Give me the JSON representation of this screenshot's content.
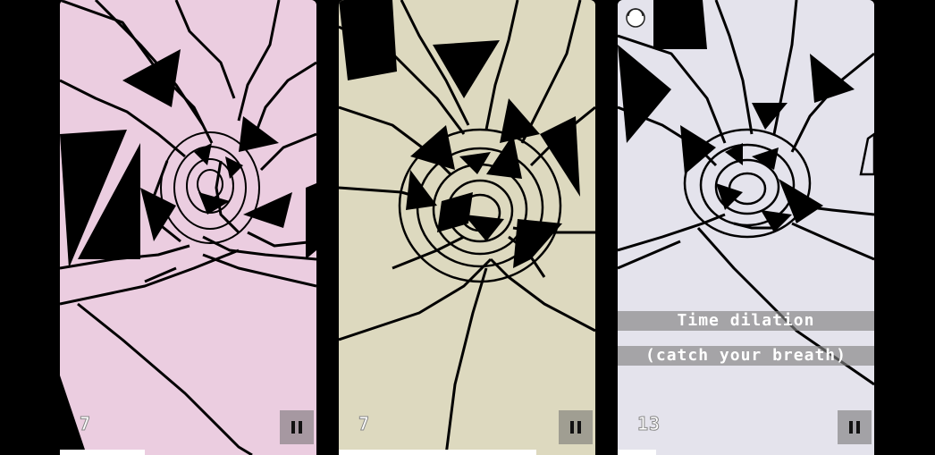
{
  "screens": [
    {
      "bg": "#ebcde0",
      "score": "7",
      "progress": 0.33
    },
    {
      "bg": "#ddd9bf",
      "score": "7",
      "progress": 0.77
    },
    {
      "bg": "#e4e3ec",
      "score": "13",
      "progress": 0.15
    }
  ],
  "powerup": {
    "line1": "Time dilation",
    "line2": "(catch your breath)"
  },
  "icons": {
    "pause": "pause-icon",
    "powerup": "powerup-ring-icon"
  }
}
